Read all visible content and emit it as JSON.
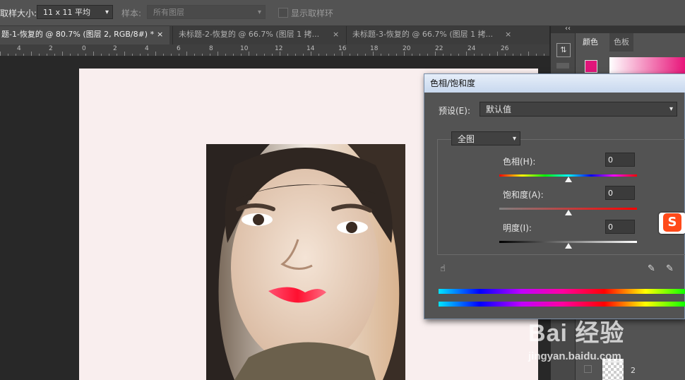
{
  "options_bar": {
    "sample_size_label": "取样大小:",
    "sample_size_value": "11 x 11 平均",
    "sample_label": "样本:",
    "sample_value": "所有图层",
    "show_ring_label": "显示取样环"
  },
  "tabs": [
    {
      "label": "题-1-恢复的 @ 80.7% (图层 2, RGB/8#) *",
      "close": "×"
    },
    {
      "label": "未标题-2-恢复的 @ 66.7% (图层 1 拷...",
      "close": "×"
    },
    {
      "label": "未标题-3-恢复的 @ 66.7% (图层 1 拷...",
      "close": "×"
    }
  ],
  "ruler": {
    "labels": [
      "4",
      "2",
      "0",
      "2",
      "4",
      "6",
      "8",
      "10",
      "12",
      "14",
      "16",
      "18",
      "20",
      "22",
      "24",
      "26"
    ]
  },
  "panels": {
    "collapse_arrows": "‹‹",
    "color_tab": "颜色",
    "swatch_tab": "色板",
    "layer_name": "2"
  },
  "dialog": {
    "title": "色相/饱和度",
    "preset_label": "预设(E):",
    "preset_value": "默认值",
    "channel_value": "全图",
    "hue_label": "色相(H):",
    "hue_value": "0",
    "saturation_label": "饱和度(A):",
    "saturation_value": "0",
    "lightness_label": "明度(I):",
    "lightness_value": "0",
    "hue_position": 0.5,
    "saturation_position": 0.5,
    "lightness_position": 0.5
  },
  "ime_logo": "S",
  "watermark": {
    "brand": "Bai 经验",
    "url": "jingyan.baidu.com"
  },
  "colors": {
    "foreground_swatch": "#e0157a",
    "dialog_title_bg": "#d4e2f3",
    "canvas_bg": "#f9eeee"
  }
}
